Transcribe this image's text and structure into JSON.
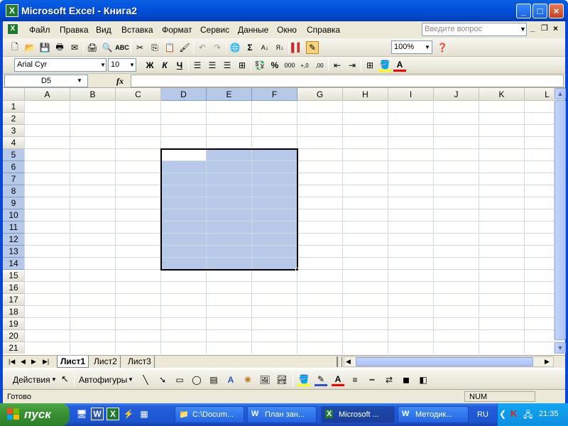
{
  "window": {
    "title": "Microsoft Excel - Книга2",
    "btn_min": "_",
    "btn_max": "□",
    "btn_close": "×"
  },
  "menu": {
    "items": [
      "Файл",
      "Правка",
      "Вид",
      "Вставка",
      "Формат",
      "Сервис",
      "Данные",
      "Окно",
      "Справка"
    ],
    "ask_placeholder": "Введите вопрос"
  },
  "toolbar": {
    "zoom": "100%",
    "font_name": "Arial Cyr",
    "font_size": "10",
    "bold": "Ж",
    "italic": "К",
    "underline": "Ч",
    "percent": "%",
    "thousands": "000",
    "sigma": "Σ"
  },
  "formula": {
    "name_box": "D5",
    "fx": "fx",
    "value": ""
  },
  "grid": {
    "columns": [
      "A",
      "B",
      "C",
      "D",
      "E",
      "F",
      "G",
      "H",
      "I",
      "J",
      "K",
      "L"
    ],
    "rows": [
      "1",
      "2",
      "3",
      "4",
      "5",
      "6",
      "7",
      "8",
      "9",
      "10",
      "11",
      "12",
      "13",
      "14",
      "15",
      "16",
      "17",
      "18",
      "19",
      "20",
      "21"
    ],
    "selection": {
      "active_cell": "D5",
      "range": "D5:F14"
    },
    "selection_color": "#b6c9e8"
  },
  "sheets": {
    "tabs": [
      "Лист1",
      "Лист2",
      "Лист3"
    ],
    "active": "Лист1"
  },
  "drawing": {
    "actions": "Действия",
    "autoshapes": "Автофигуры"
  },
  "status": {
    "ready": "Готово",
    "num": "NUM"
  },
  "taskbar": {
    "start": "пуск",
    "tasks": [
      "C:\\Docum...",
      "План зан...",
      "Microsoft ...",
      "Методик..."
    ],
    "lang": "RU",
    "clock": "21:35"
  }
}
